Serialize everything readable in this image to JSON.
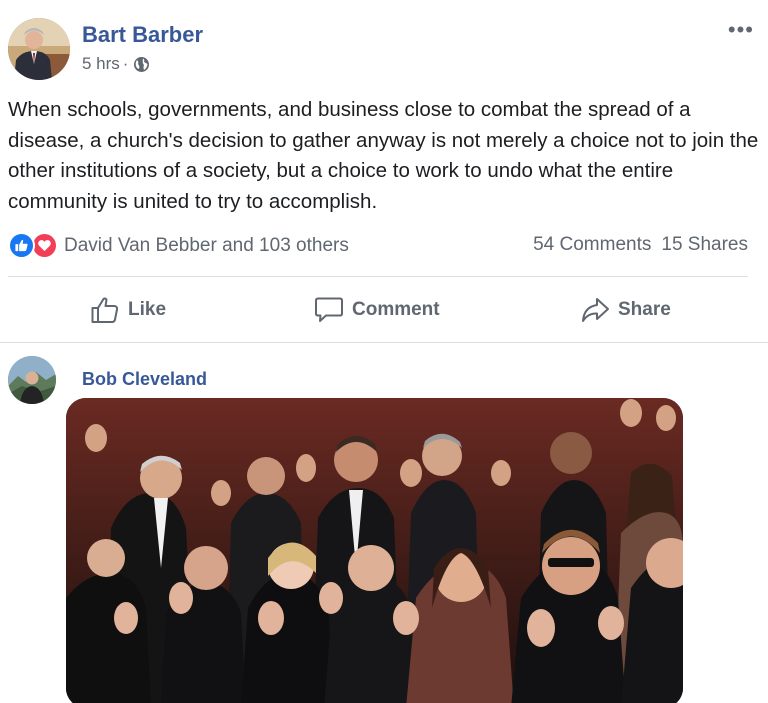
{
  "post": {
    "author": "Bart Barber",
    "time": "5 hrs",
    "separator": "·",
    "privacy_icon": "globe-icon",
    "more_icon": "ellipsis-icon",
    "more_label": "•••",
    "text": "When schools, governments, and business close to combat the spread of a disease, a church's decision to gather anyway is not merely a choice not to join the other institutions of a society, but a choice to work to undo what the entire community is united to try to accomplish."
  },
  "reactions": {
    "icons": [
      "like-reaction-icon",
      "love-reaction-icon"
    ],
    "summary": "David Van Bebber and 103 others",
    "comments": "54 Comments",
    "shares": "15 Shares"
  },
  "actions": {
    "like": "Like",
    "comment": "Comment",
    "share": "Share"
  },
  "comment": {
    "author": "Bob Cleveland",
    "attachment": "gif-image"
  },
  "colors": {
    "name_link": "#385898",
    "secondary_text": "#606770",
    "like_blue": "#1877f2",
    "love_red": "#f33e58",
    "divider": "#dadde1"
  }
}
